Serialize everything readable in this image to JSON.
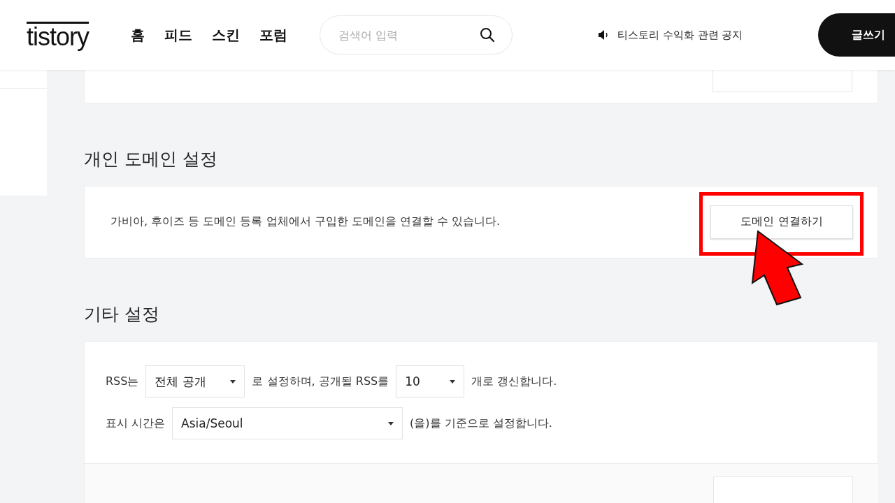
{
  "header": {
    "logo": "tistory",
    "nav": [
      {
        "label": "홈"
      },
      {
        "label": "피드"
      },
      {
        "label": "스킨"
      },
      {
        "label": "포럼"
      }
    ],
    "search": {
      "placeholder": "검색어 입력"
    },
    "notice": "티스토리 수익화 관련 공지",
    "write_button": "글쓰기"
  },
  "domain_section": {
    "title": "개인 도메인 설정",
    "description": "가비아, 후이즈 등 도메인 등록 업체에서 구입한 도메인을 연결할 수 있습니다.",
    "button": "도메인 연결하기",
    "highlighted": true
  },
  "other_section": {
    "title": "기타 설정",
    "rss_row": {
      "prefix": "RSS는",
      "visibility": "전체 공개",
      "middle": "로 설정하며, 공개될 RSS를",
      "count": "10",
      "suffix": "개로 갱신합니다."
    },
    "time_row": {
      "prefix": "표시 시간은",
      "timezone": "Asia/Seoul",
      "suffix": "(을)를 기준으로 설정합니다."
    }
  }
}
